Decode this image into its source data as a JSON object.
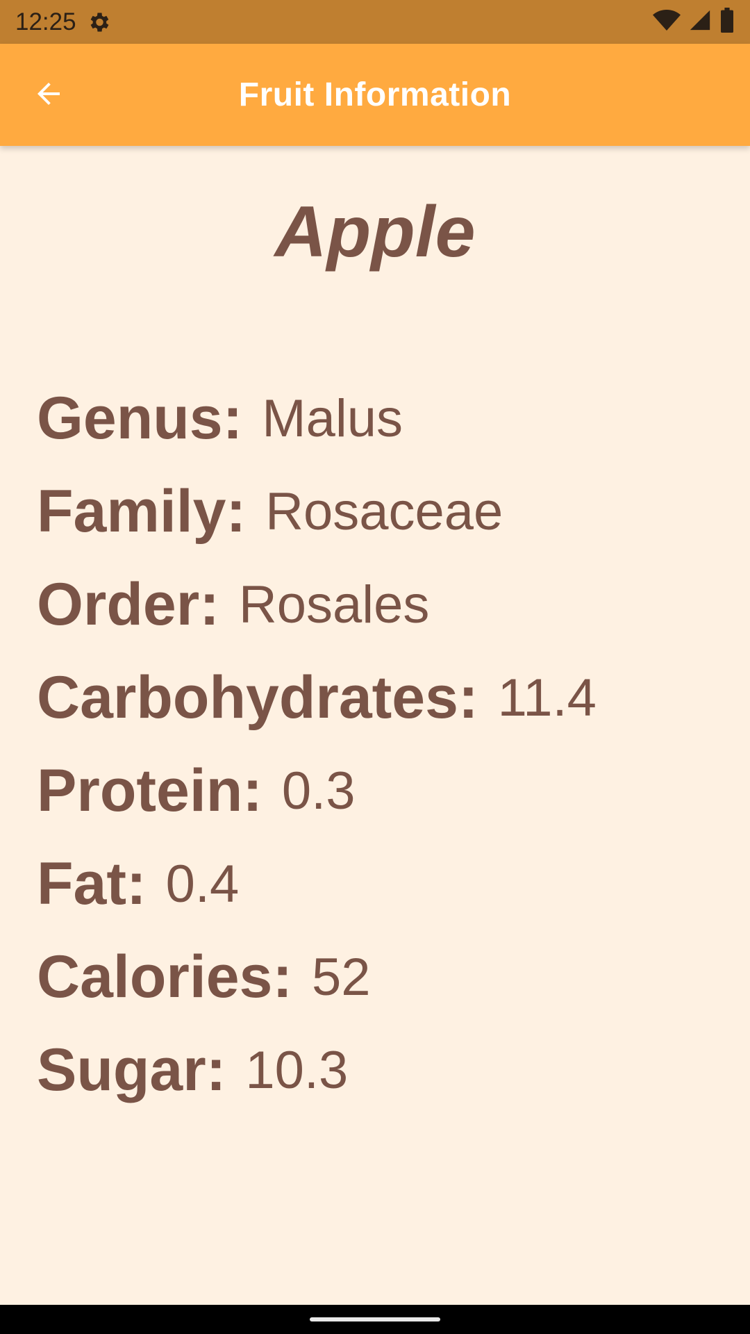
{
  "status_bar": {
    "time": "12:25",
    "icons": [
      "settings-icon",
      "wifi-icon",
      "signal-icon",
      "battery-icon"
    ]
  },
  "app_bar": {
    "title": "Fruit Information",
    "back_icon": "arrow-back-icon",
    "background_color": "#FFAA40"
  },
  "fruit": {
    "name": "Apple",
    "details": [
      {
        "label": "Genus:",
        "value": "Malus"
      },
      {
        "label": "Family:",
        "value": "Rosaceae"
      },
      {
        "label": "Order:",
        "value": "Rosales"
      },
      {
        "label": "Carbohydrates:",
        "value": "11.4"
      },
      {
        "label": "Protein:",
        "value": "0.3"
      },
      {
        "label": "Fat:",
        "value": "0.4"
      },
      {
        "label": "Calories:",
        "value": "52"
      },
      {
        "label": "Sugar:",
        "value": "10.3"
      }
    ]
  },
  "colors": {
    "status_bar": "#BF7F30",
    "page_background": "#FEF1E2",
    "text": "#7A5447"
  }
}
